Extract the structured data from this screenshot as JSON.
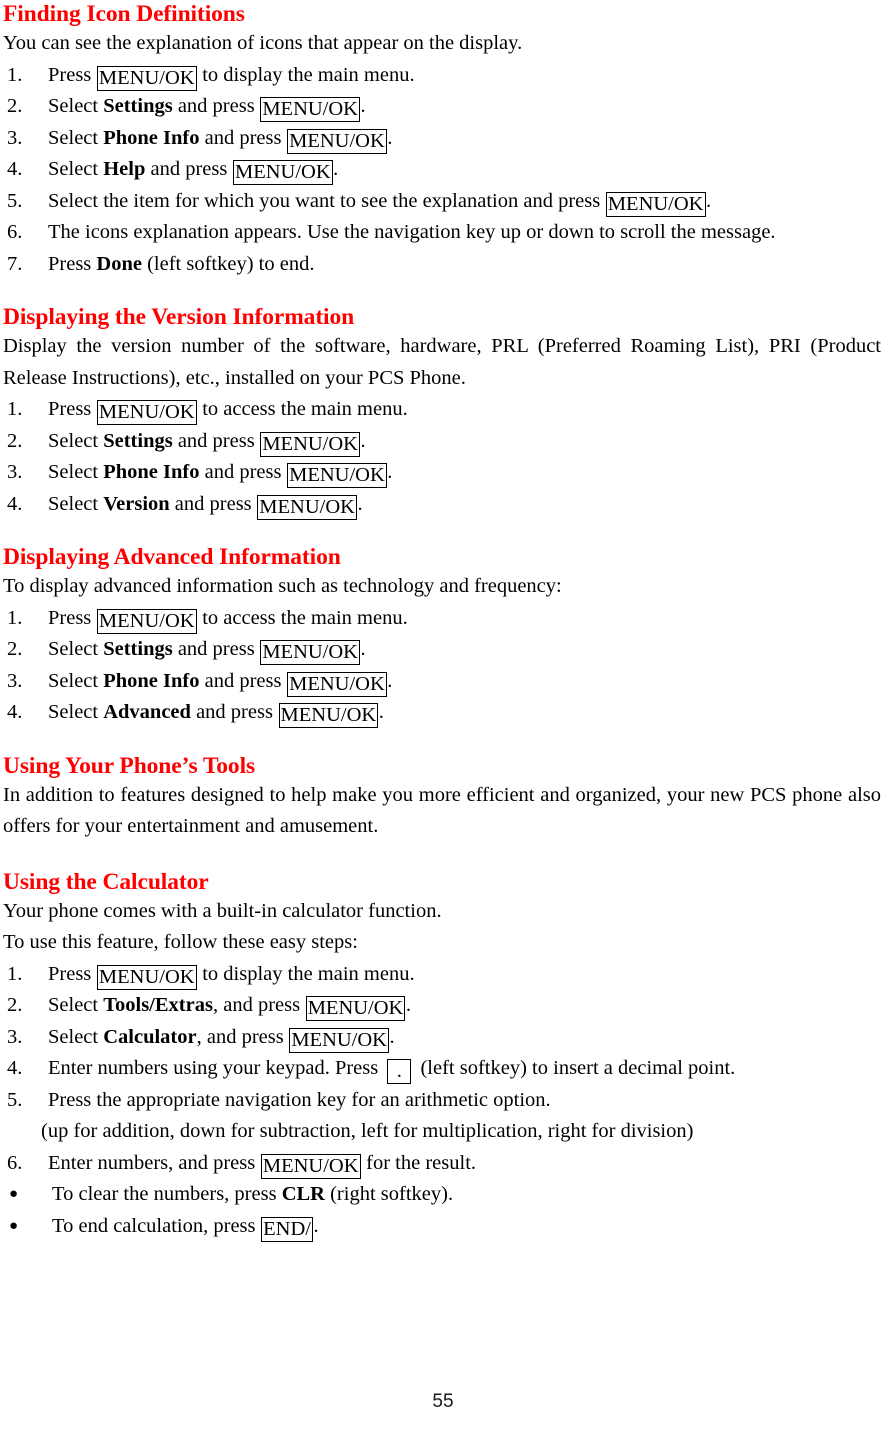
{
  "page": {
    "number": "55",
    "heading_color": "#ff0000",
    "body_color": "#000000"
  },
  "sections": [
    {
      "id": "finding-icon-definitions",
      "heading": "Finding Icon Definitions",
      "intro": "You can see the explanation of icons that appear on the display.",
      "steps": [
        {
          "num": "1.",
          "pre": "Press ",
          "key": "MENU/OK",
          "post": " to display the main menu."
        },
        {
          "num": "2.",
          "pre": "Select ",
          "bold": "Settings",
          "mid": " and press ",
          "key": "MENU/OK",
          "post": "."
        },
        {
          "num": "3.",
          "pre": "Select ",
          "bold": "Phone Info",
          "mid": " and press ",
          "key": "MENU/OK",
          "post": "."
        },
        {
          "num": "4.",
          "pre": "Select ",
          "bold": "Help",
          "mid": " and press ",
          "key": "MENU/OK",
          "post": "."
        },
        {
          "num": "5.",
          "pre": "Select the item for which you want to see the explanation and press ",
          "key": "MENU/OK",
          "post": "."
        },
        {
          "num": "6.",
          "pre": "The icons explanation appears. Use the navigation key up or down to scroll the message."
        },
        {
          "num": "7.",
          "pre": "Press ",
          "bold": "Done",
          "mid": " (left softkey) to end."
        }
      ]
    },
    {
      "id": "displaying-version-information",
      "heading": "Displaying the Version Information",
      "intro": "Display the version number of the software, hardware, PRL (Preferred Roaming List), PRI (Product Release Instructions), etc., installed on your PCS Phone.",
      "steps": [
        {
          "num": "1.",
          "pre": "Press ",
          "key": "MENU/OK",
          "post": " to access the main menu."
        },
        {
          "num": "2.",
          "pre": "Select ",
          "bold": "Settings",
          "mid": " and press ",
          "key": "MENU/OK",
          "post": "."
        },
        {
          "num": "3.",
          "pre": "Select ",
          "bold": "Phone Info",
          "mid": " and press ",
          "key": "MENU/OK",
          "post": "."
        },
        {
          "num": "4.",
          "pre": "Select ",
          "bold": "Version",
          "mid": " and press ",
          "key": "MENU/OK",
          "post": "."
        }
      ]
    },
    {
      "id": "displaying-advanced-information",
      "heading": "Displaying Advanced Information",
      "intro": "To display advanced information such as technology and frequency:",
      "steps": [
        {
          "num": "1.",
          "pre": "Press ",
          "key": "MENU/OK",
          "post": " to access the main menu."
        },
        {
          "num": "2.",
          "pre": "Select ",
          "bold": "Settings",
          "mid": " and press ",
          "key": "MENU/OK",
          "post": "."
        },
        {
          "num": "3.",
          "pre": "Select ",
          "bold": "Phone Info",
          "mid": " and press ",
          "key": "MENU/OK",
          "post": "."
        },
        {
          "num": "4.",
          "pre": "Select ",
          "bold": "Advanced",
          "mid": " and press ",
          "key": "MENU/OK",
          "post": "."
        }
      ]
    },
    {
      "id": "using-your-phones-tools",
      "heading": "Using Your Phone’s Tools",
      "intro": "In addition to features designed to help make you more efficient and organized, your new PCS phone also offers for your entertainment and amusement."
    },
    {
      "id": "using-the-calculator",
      "heading": "Using the Calculator",
      "intro": "Your phone comes with a built-in calculator function.",
      "intro2": "To use this feature, follow these easy steps:",
      "steps": [
        {
          "num": "1.",
          "pre": "Press ",
          "key": "MENU/OK",
          "post": " to display the main menu."
        },
        {
          "num": "2.",
          "pre": "Select ",
          "bold": "Tools/Extras",
          "mid": ", and press ",
          "key": "MENU/OK",
          "post": "."
        },
        {
          "num": "3.",
          "pre": "Select ",
          "bold": "Calculator",
          "mid": ", and press ",
          "key": "MENU/OK",
          "post": "."
        },
        {
          "num": "4.",
          "pre": "Enter numbers using your keypad. Press ",
          "key": ".",
          "post": " (left softkey) to insert a decimal point."
        },
        {
          "num": "5.",
          "pre": "Press the appropriate navigation key for an arithmetic option."
        },
        {
          "num": "6.",
          "pre": "Enter numbers, and press ",
          "key": "MENU/OK",
          "post": " for the result."
        }
      ],
      "step5_subline": "(up for addition, down for subtraction, left for multiplication, right for division)",
      "bullets": [
        {
          "marker": "●",
          "pre": " To clear the numbers, press ",
          "bold": "CLR",
          "mid": " (right softkey)."
        },
        {
          "marker": "●",
          "pre": " To end calculation, press ",
          "key": "END/",
          "post": "."
        }
      ]
    }
  ]
}
